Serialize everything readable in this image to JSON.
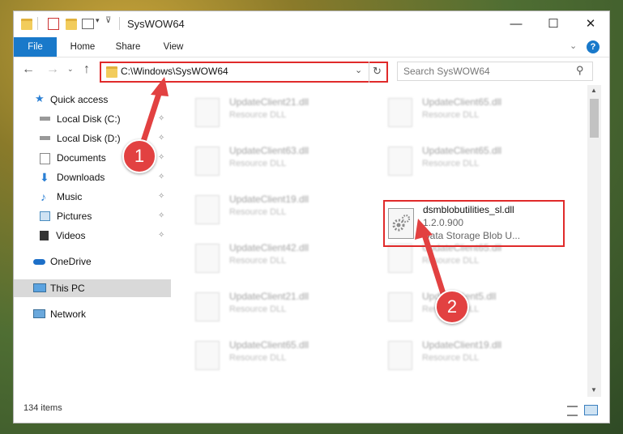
{
  "window": {
    "title": "SysWOW64"
  },
  "ribbon": {
    "tabs": [
      "File",
      "Home",
      "Share",
      "View"
    ]
  },
  "address": {
    "path": "C:\\Windows\\SysWOW64"
  },
  "search": {
    "placeholder": "Search SysWOW64"
  },
  "nav": {
    "quick_access": "Quick access",
    "pinned": [
      "Local Disk (C:)",
      "Local Disk (D:)",
      "Documents",
      "Downloads",
      "Music",
      "Pictures",
      "Videos"
    ],
    "onedrive": "OneDrive",
    "thispc": "This PC",
    "network": "Network"
  },
  "files": [
    {
      "name": "UpdateClient21.dll",
      "type": "Resource DLL"
    },
    {
      "name": "UpdateClient65.dll",
      "type": "Resource DLL"
    },
    {
      "name": "UpdateClient63.dll",
      "type": "Resource DLL"
    },
    {
      "name": "UpdateClient65.dll",
      "type": "Resource DLL"
    },
    {
      "name": "UpdateClient19.dll",
      "type": "Resource DLL"
    },
    {
      "name": "UpdateClient42.dll",
      "type": "Resource DLL"
    },
    {
      "name": "UpdateClient65.dll",
      "type": "Resource DLL"
    },
    {
      "name": "UpdateClient21.dll",
      "type": "Resource DLL"
    },
    {
      "name": "UpdateClient5.dll",
      "type": "Resource DLL"
    },
    {
      "name": "UpdateClient65.dll",
      "type": "Resource DLL"
    },
    {
      "name": "UpdateClient19.dll",
      "type": "Resource DLL"
    }
  ],
  "highlight": {
    "name": "dsmblobutilities_sl.dll",
    "version": "1.2.0.900",
    "description": "Data Storage Blob U..."
  },
  "status": {
    "count": "134 items"
  },
  "annotations": {
    "step1": "1",
    "step2": "2"
  },
  "colors": {
    "accent": "#1979ca",
    "annotation": "#e02a2a"
  }
}
